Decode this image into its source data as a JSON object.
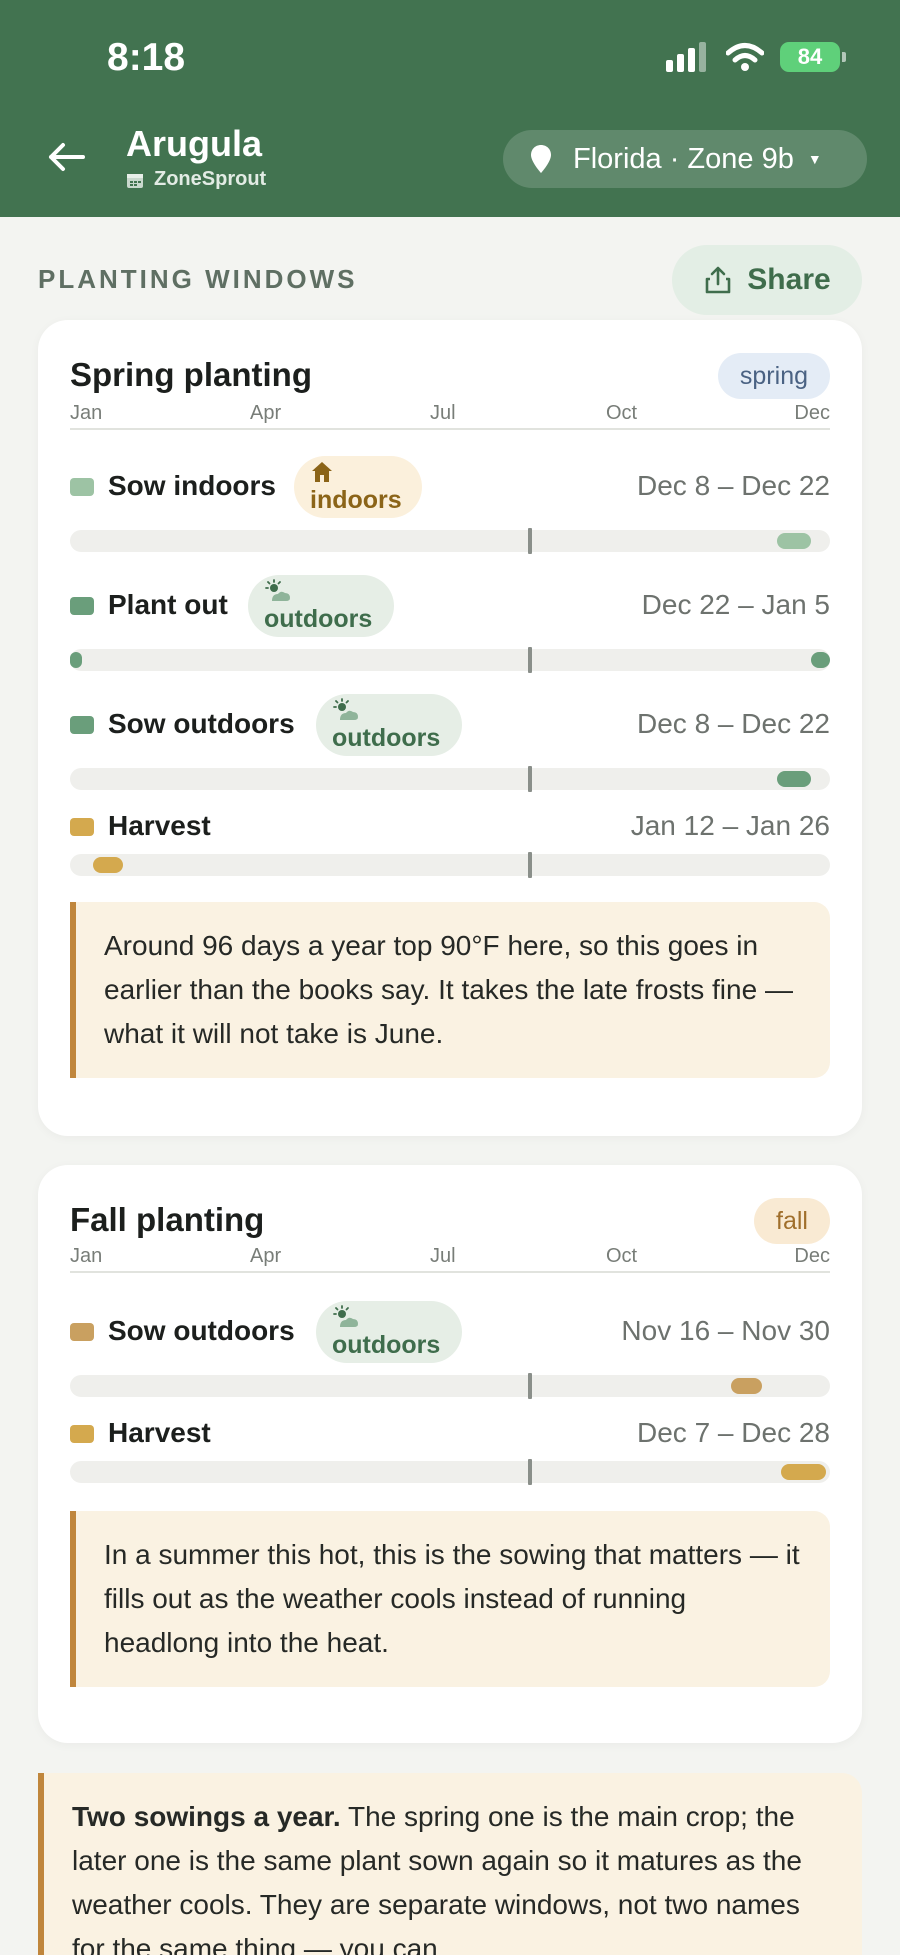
{
  "status_bar": {
    "time": "8:18",
    "battery": "84"
  },
  "header": {
    "title": "Arugula",
    "app_name": "ZoneSprout",
    "location": "Florida · Zone 9b"
  },
  "section": {
    "title": "PLANTING WINDOWS",
    "share_label": "Share"
  },
  "months": [
    "Jan",
    "Apr",
    "Jul",
    "Oct",
    "Dec"
  ],
  "colors": {
    "header": "#427350",
    "indoors": "#9dc3a4",
    "outdoors": "#6a9e7b",
    "harvest": "#d4a94e",
    "fall_sow": "#c9a060",
    "note_accent": "#c0863c"
  },
  "cards": [
    {
      "title": "Spring planting",
      "badge": "spring",
      "rows": [
        {
          "label": "Sow indoors",
          "tag": "indoors",
          "tag_icon": "house-icon",
          "range": "Dec 8 – Dec 22",
          "color": "#9dc3a4",
          "bars": [
            [
              0.93,
              0.975
            ]
          ]
        },
        {
          "label": "Plant out",
          "tag": "outdoors",
          "tag_icon": "sun-cloud-icon",
          "range": "Dec 22 – Jan 5",
          "color": "#6a9e7b",
          "bars": [
            [
              0.0,
              0.013
            ],
            [
              0.975,
              1.0
            ]
          ]
        },
        {
          "label": "Sow outdoors",
          "tag": "outdoors",
          "tag_icon": "sun-cloud-icon",
          "range": "Dec 8 – Dec 22",
          "color": "#6a9e7b",
          "bars": [
            [
              0.93,
              0.975
            ]
          ]
        },
        {
          "label": "Harvest",
          "tag": "",
          "tag_icon": "",
          "range": "Jan 12 – Jan 26",
          "color": "#d4a94e",
          "bars": [
            [
              0.03,
              0.07
            ]
          ]
        }
      ],
      "note": "Around 96 days a year top 90°F here, so this goes in earlier than the books say. It takes the late frosts fine — what it will not take is June."
    },
    {
      "title": "Fall planting",
      "badge": "fall",
      "rows": [
        {
          "label": "Sow outdoors",
          "tag": "outdoors",
          "tag_icon": "sun-cloud-icon",
          "range": "Nov 16 – Nov 30",
          "color": "#c9a060",
          "bars": [
            [
              0.87,
              0.91
            ]
          ]
        },
        {
          "label": "Harvest",
          "tag": "",
          "tag_icon": "",
          "range": "Dec 7 – Dec 28",
          "color": "#d4a94e",
          "bars": [
            [
              0.935,
              0.995
            ]
          ]
        }
      ],
      "note": "In a summer this hot, this is the sowing that matters — it fills out as the weather cools instead of running headlong into the heat."
    }
  ],
  "bottom_note": {
    "bold": "Two sowings a year.",
    "text": " The spring one is the main crop; the later one is the same plant sown again so it matures as the weather cools. They are separate windows, not two names for the same thing — you can"
  }
}
